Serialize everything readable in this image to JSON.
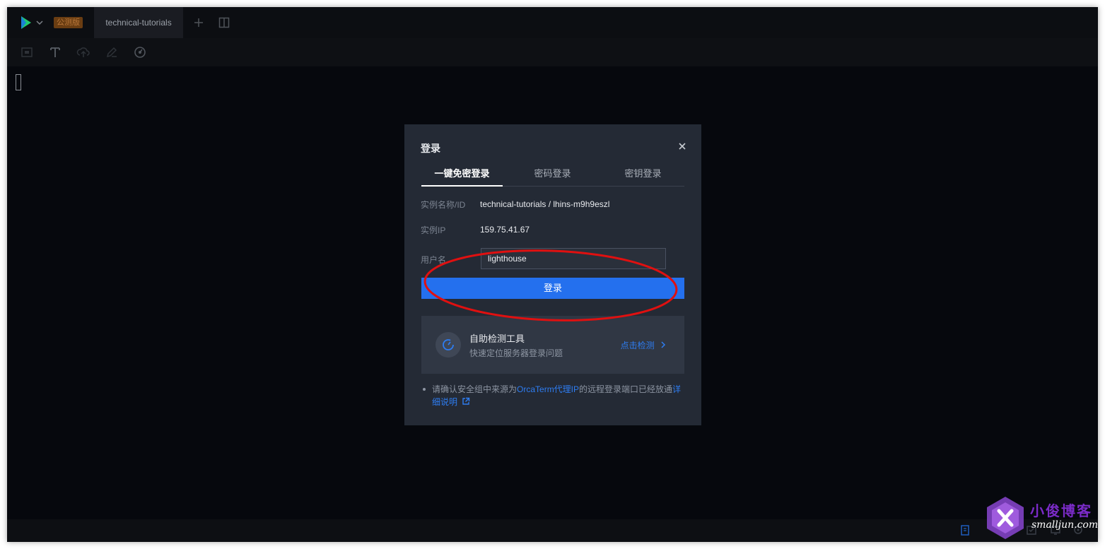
{
  "titlebar": {
    "badge": "公测版",
    "tab_label": "technical-tutorials"
  },
  "modal": {
    "title": "登录",
    "tabs": [
      {
        "label": "一键免密登录",
        "active": true
      },
      {
        "label": "密码登录",
        "active": false
      },
      {
        "label": "密钥登录",
        "active": false
      }
    ],
    "fields": {
      "instance_label": "实例名称/ID",
      "instance_value": "technical-tutorials / lhins-m9h9eszl",
      "ip_label": "实例IP",
      "ip_value": "159.75.41.67",
      "username_label": "用户名",
      "username_value": "lighthouse"
    },
    "login_button": "登录",
    "diagnostic": {
      "title": "自助检测工具",
      "subtitle": "快速定位服务器登录问题",
      "link": "点击检测"
    },
    "note": {
      "part1": "请确认安全组中来源为",
      "link1": "OrcaTerm代理IP",
      "part2": "的远程登录端口已经放通",
      "link2": "详细说明"
    }
  },
  "watermark": {
    "title": "小俊博客",
    "url": "smalljun.com"
  },
  "colors": {
    "accent": "#2470ee",
    "link": "#2e7df2",
    "annotation": "#e01010",
    "badge_bg": "#6a3d12"
  },
  "icons": [
    "logo-icon",
    "chevron-down-icon",
    "plus-icon",
    "split-view-icon",
    "screenshot-icon",
    "text-icon",
    "upload-icon",
    "edit-icon",
    "speed-icon",
    "close-icon",
    "diagnostic-icon",
    "chevron-right-icon",
    "external-link-icon"
  ]
}
